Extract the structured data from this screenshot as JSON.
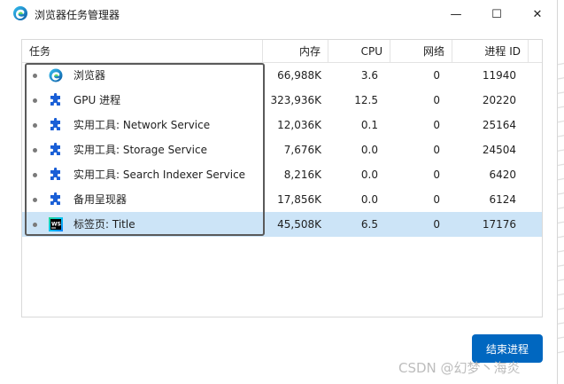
{
  "window": {
    "title": "浏览器任务管理器",
    "minimize_glyph": "—",
    "maximize_glyph": "☐",
    "close_glyph": "✕"
  },
  "table": {
    "headers": {
      "task": "任务",
      "memory": "内存",
      "cpu": "CPU",
      "network": "网络",
      "pid": "进程 ID"
    },
    "rows": [
      {
        "icon": "edge-icon",
        "task": "浏览器",
        "memory": "66,988K",
        "cpu": "3.6",
        "network": "0",
        "pid": "11940",
        "selected": false
      },
      {
        "icon": "puzzle-icon",
        "task": "GPU 进程",
        "memory": "323,936K",
        "cpu": "12.5",
        "network": "0",
        "pid": "20220",
        "selected": false
      },
      {
        "icon": "puzzle-icon",
        "task": "实用工具: Network Service",
        "memory": "12,036K",
        "cpu": "0.1",
        "network": "0",
        "pid": "25164",
        "selected": false
      },
      {
        "icon": "puzzle-icon",
        "task": "实用工具: Storage Service",
        "memory": "7,676K",
        "cpu": "0.0",
        "network": "0",
        "pid": "24504",
        "selected": false
      },
      {
        "icon": "puzzle-icon",
        "task": "实用工具: Search Indexer Service",
        "memory": "8,216K",
        "cpu": "0.0",
        "network": "0",
        "pid": "6420",
        "selected": false
      },
      {
        "icon": "puzzle-icon",
        "task": "备用呈现器",
        "memory": "17,856K",
        "cpu": "0.0",
        "network": "0",
        "pid": "6124",
        "selected": false
      },
      {
        "icon": "webstorm-icon",
        "task": "标签页: Title",
        "memory": "45,508K",
        "cpu": "6.5",
        "network": "0",
        "pid": "17176",
        "selected": true
      }
    ]
  },
  "actions": {
    "end_process_label": "结束进程"
  },
  "watermark": "CSDN @幻梦丶海炎",
  "colors": {
    "accent": "#0067c0",
    "selected_row": "#cce4f7",
    "puzzle": "#1a5fd6"
  }
}
